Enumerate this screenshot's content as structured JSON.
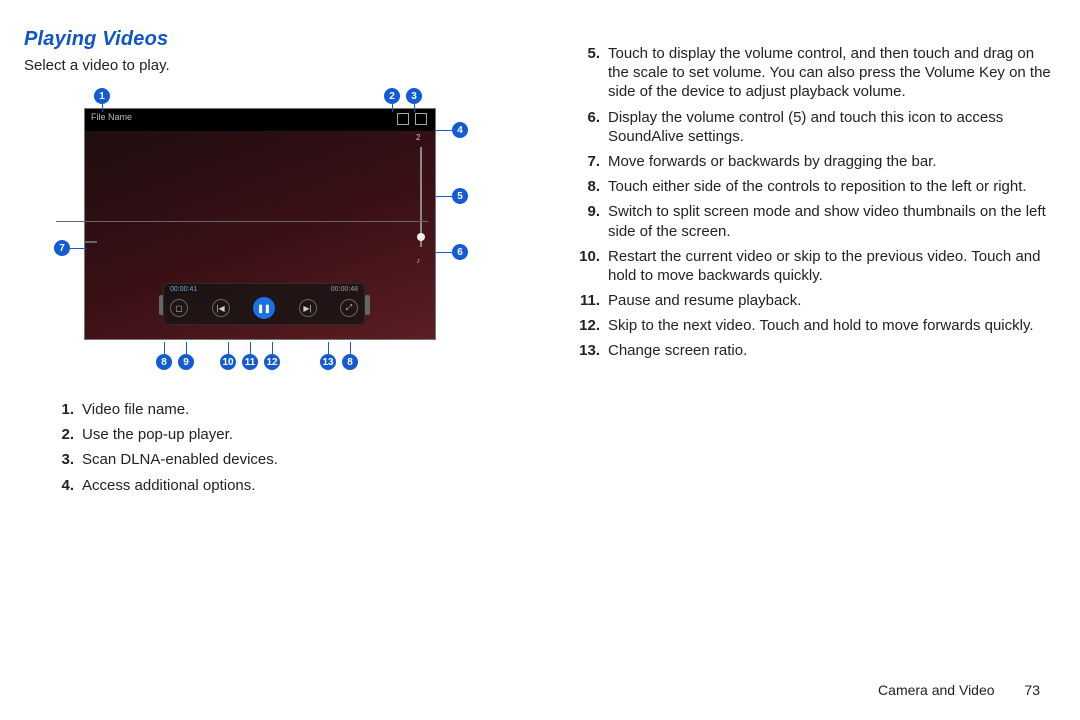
{
  "heading": "Playing Videos",
  "intro": "Select a video to play.",
  "figure": {
    "filename": "File Name",
    "volume_value": "2",
    "time_left": "00:00:41",
    "time_right": "00:00:48"
  },
  "callouts": [
    "1",
    "2",
    "3",
    "4",
    "5",
    "6",
    "7",
    "8",
    "9",
    "10",
    "11",
    "12",
    "13",
    "8"
  ],
  "left_list": [
    "Video file name.",
    "Use the pop-up player.",
    "Scan DLNA-enabled devices.",
    "Access additional options."
  ],
  "right_list": [
    "Touch to display the volume control, and then touch and drag on the scale to set volume. You can also press the Volume Key on the side of the device to adjust playback volume.",
    "Display the volume control (5) and touch this icon to access SoundAlive settings.",
    "Move forwards or backwards by dragging the bar.",
    "Touch either side of the controls to reposition to the left or right.",
    "Switch to split screen mode and show video thumbnails on the left side of the screen.",
    "Restart the current video or skip to the previous video. Touch and hold to move backwards quickly.",
    "Pause and resume playback.",
    "Skip to the next video. Touch and hold to move forwards quickly.",
    "Change screen ratio."
  ],
  "footer": {
    "section": "Camera and Video",
    "page": "73"
  }
}
